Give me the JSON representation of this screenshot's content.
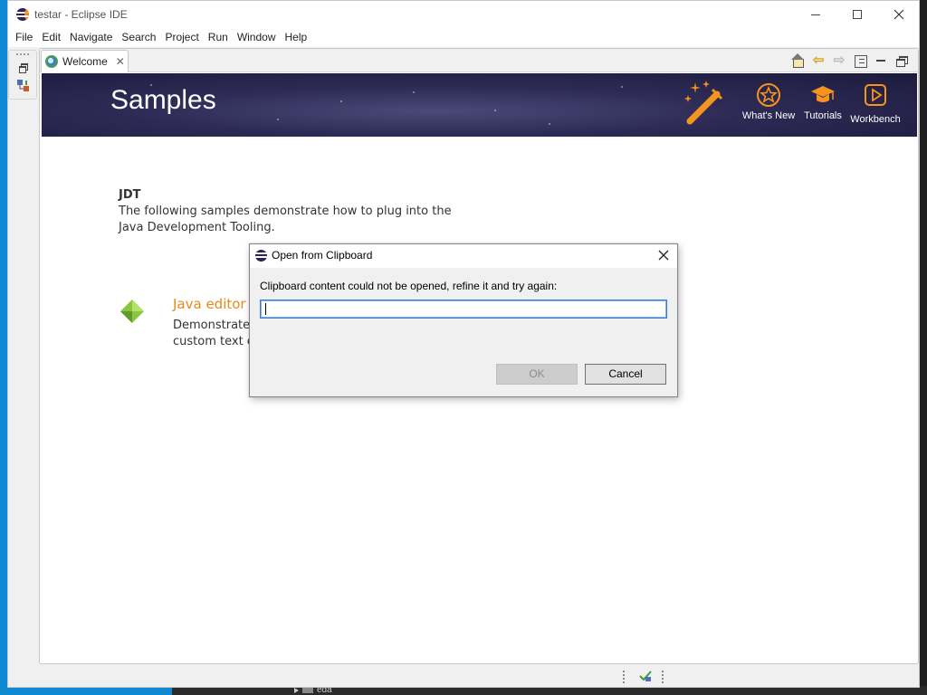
{
  "window": {
    "title": "testar - Eclipse IDE"
  },
  "menubar": {
    "items": [
      "File",
      "Edit",
      "Navigate",
      "Search",
      "Project",
      "Run",
      "Window",
      "Help"
    ]
  },
  "editor": {
    "tab_label": "Welcome",
    "toolbar_icons": [
      "home-icon",
      "back-arrow-icon",
      "forward-arrow-icon",
      "layout-icon",
      "minimize-icon",
      "maximize-icon"
    ]
  },
  "banner": {
    "title": "Samples",
    "nav": [
      {
        "label": "What's New",
        "icon": "star-icon"
      },
      {
        "label": "Tutorials",
        "icon": "graduation-cap-icon"
      },
      {
        "label": "Workbench",
        "icon": "play-icon"
      }
    ],
    "accent_color": "#f7941e"
  },
  "content": {
    "section_title": "JDT",
    "section_desc_line1": "The following samples demonstrate how to plug into the",
    "section_desc_line2": "Java Development Tooling.",
    "sample_title": "Java editor",
    "sample_desc_line1": "Demonstrates",
    "sample_desc_line2": "custom text e"
  },
  "dialog": {
    "title": "Open from Clipboard",
    "message": "Clipboard content could not be opened, refine it and try again:",
    "input_value": "",
    "ok_label": "OK",
    "cancel_label": "Cancel"
  },
  "background": {
    "taskbar_item": "eda"
  }
}
